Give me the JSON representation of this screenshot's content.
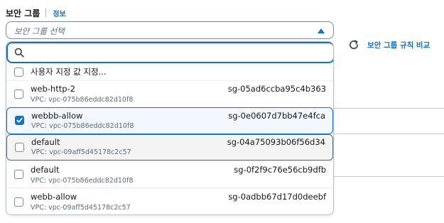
{
  "form": {
    "label": "보안 그룹",
    "info_link": "정보",
    "select_placeholder": "보안 그룹 선택",
    "compare_link": "보안 그룹 규칙 비교"
  },
  "search": {
    "value": "",
    "placeholder": ""
  },
  "options": [
    {
      "name": "사용자 지정 값 지정...",
      "vpc": "",
      "id": "",
      "checked": false
    },
    {
      "name": "web-http-2",
      "vpc": "VPC: vpc-075b86eddc82d10f8",
      "id": "sg-05ad6ccba95c4b363",
      "checked": false
    },
    {
      "name": "webbb-allow",
      "vpc": "VPC: vpc-075b86eddc82d10f8",
      "id": "sg-0e0607d7bb47e4fca",
      "checked": true
    },
    {
      "name": "default",
      "vpc": "VPC: vpc-09aff5d45178c2c57",
      "id": "sg-04a75093b06f56d34",
      "checked": false
    },
    {
      "name": "default",
      "vpc": "VPC: vpc-075b86eddc82d10f8",
      "id": "sg-0f2f9c76e56cb9dfb",
      "checked": false
    },
    {
      "name": "webb-allow",
      "vpc": "VPC: vpc-09aff5d45178c2c57",
      "id": "sg-0adbb67d17d0deebf",
      "checked": false
    }
  ],
  "colors": {
    "accent": "#0972d3",
    "text": "#16191f",
    "muted": "#5f6b7a"
  },
  "icons": {
    "caret": "caret-up-icon",
    "refresh": "refresh-icon",
    "search": "search-icon",
    "check": "checkmark-icon"
  }
}
